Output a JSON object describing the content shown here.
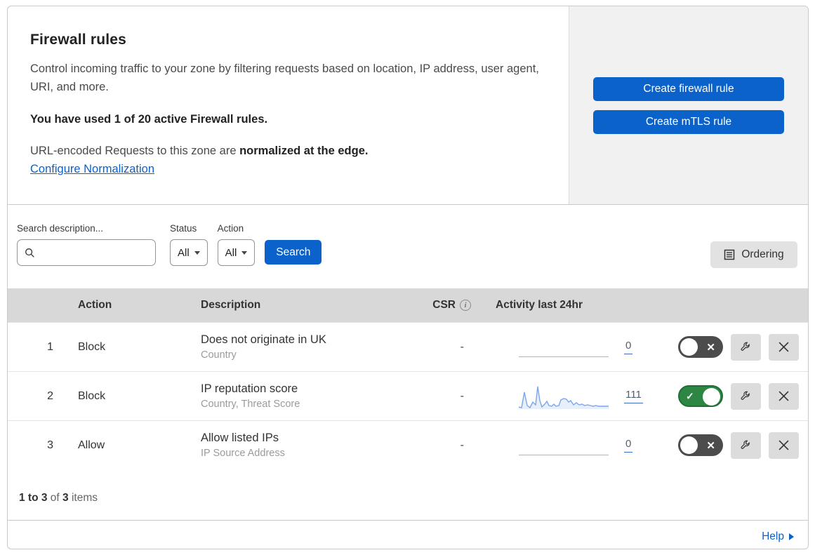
{
  "header": {
    "title": "Firewall rules",
    "description": "Control incoming traffic to your zone by filtering requests based on location, IP address, user agent, URI, and more.",
    "usage": "You have used 1 of 20 active Firewall rules.",
    "normalization_prefix": "URL-encoded Requests to this zone are ",
    "normalization_bold": "normalized at the edge.",
    "normalization_link": "Configure Normalization",
    "create_firewall_button": "Create firewall rule",
    "create_mtls_button": "Create mTLS rule"
  },
  "filters": {
    "search_label": "Search description...",
    "status_label": "Status",
    "status_value": "All",
    "action_label": "Action",
    "action_value": "All",
    "search_button": "Search",
    "ordering_button": "Ordering"
  },
  "table": {
    "columns": {
      "action": "Action",
      "description": "Description",
      "csr": "CSR",
      "activity": "Activity last 24hr"
    },
    "rows": [
      {
        "index": "1",
        "action": "Block",
        "description": "Does not originate in UK",
        "fields": "Country",
        "csr": "-",
        "activity_count": "0",
        "enabled": false,
        "sparkline": null
      },
      {
        "index": "2",
        "action": "Block",
        "description": "IP reputation score",
        "fields": "Country, Threat Score",
        "csr": "-",
        "activity_count": "111",
        "enabled": true,
        "sparkline": [
          [
            0,
            33
          ],
          [
            4,
            34
          ],
          [
            8,
            12
          ],
          [
            12,
            31
          ],
          [
            16,
            34
          ],
          [
            20,
            26
          ],
          [
            24,
            30
          ],
          [
            27,
            4
          ],
          [
            30,
            24
          ],
          [
            33,
            33
          ],
          [
            37,
            29
          ],
          [
            40,
            25
          ],
          [
            43,
            31
          ],
          [
            47,
            32
          ],
          [
            50,
            29
          ],
          [
            53,
            32
          ],
          [
            57,
            31
          ],
          [
            60,
            23
          ],
          [
            64,
            21
          ],
          [
            68,
            22
          ],
          [
            71,
            26
          ],
          [
            74,
            24
          ],
          [
            78,
            30
          ],
          [
            82,
            27
          ],
          [
            86,
            30
          ],
          [
            90,
            29
          ],
          [
            94,
            31
          ],
          [
            98,
            30
          ],
          [
            102,
            31
          ],
          [
            106,
            32
          ],
          [
            110,
            31
          ],
          [
            114,
            32
          ],
          [
            118,
            32
          ],
          [
            122,
            32
          ],
          [
            128,
            32
          ]
        ]
      },
      {
        "index": "3",
        "action": "Allow",
        "description": "Allow listed IPs",
        "fields": "IP Source Address",
        "csr": "-",
        "activity_count": "0",
        "enabled": false,
        "sparkline": null
      }
    ]
  },
  "footer": {
    "range": "1 to 3",
    "of_text": "of",
    "total": "3",
    "items_text": "items",
    "help_label": "Help"
  },
  "colors": {
    "accent_blue": "#0b62cb",
    "toggle_green": "#2e8644",
    "toggle_off_gray": "#4c4c4c",
    "sparkline_blue": "#7ba6ea"
  }
}
